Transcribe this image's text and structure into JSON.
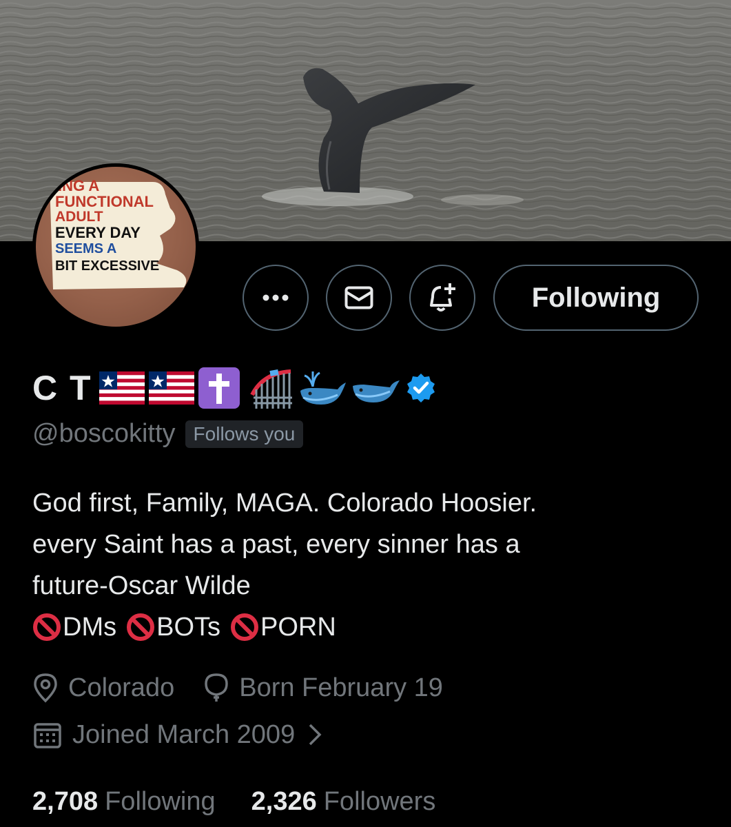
{
  "profile": {
    "display_name": "C T",
    "handle": "@boscokitty",
    "follows_you": "Follows you",
    "verified": true,
    "name_emojis": [
      "flag-liberia-icon",
      "flag-liberia-icon",
      "latin-cross-icon",
      "roller-coaster-icon",
      "spouting-whale-icon",
      "whale-icon"
    ],
    "bio": {
      "line1": "God first, Family, MAGA. Colorado Hoosier.",
      "line2": "every Saint has a past, every sinner has a",
      "line3": "future-Oscar Wilde",
      "restrictions": [
        "DMs",
        "BOTs",
        "PORN"
      ]
    },
    "location": "Colorado",
    "birthday": "Born February 19",
    "joined": "Joined March 2009",
    "avatar_text": [
      "ING A",
      "FUNCTIONAL",
      "ADULT",
      "EVERY DAY",
      "SEEMS A",
      "BIT EXCESSIVE"
    ]
  },
  "actions": {
    "more_icon": "ellipsis-icon",
    "message_icon": "envelope-icon",
    "notify_icon": "bell-plus-icon",
    "follow_label": "Following"
  },
  "stats": {
    "following_count": "2,708",
    "following_label": "Following",
    "followers_count": "2,326",
    "followers_label": "Followers"
  },
  "colors": {
    "background": "#000000",
    "text_primary": "#e7e9ea",
    "text_secondary": "#71767b",
    "button_border": "#536471",
    "verified_blue": "#1d9bf0",
    "prohibited_red": "#dd2e44"
  }
}
